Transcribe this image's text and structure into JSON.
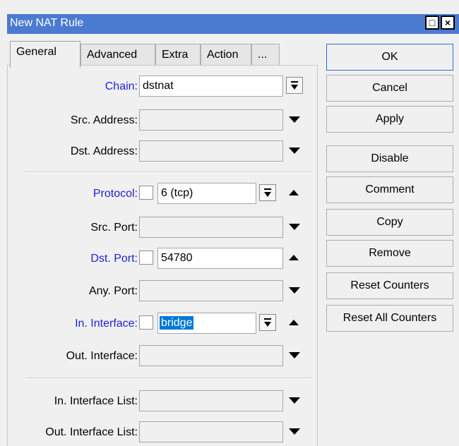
{
  "window": {
    "title": "New NAT Rule",
    "restore_label": "□",
    "close_label": "×"
  },
  "tabs": [
    "General",
    "Advanced",
    "Extra",
    "Action",
    "..."
  ],
  "fields": {
    "chain": {
      "label": "Chain:",
      "value": "dstnat"
    },
    "src_address": {
      "label": "Src. Address:",
      "value": ""
    },
    "dst_address": {
      "label": "Dst. Address:",
      "value": ""
    },
    "protocol": {
      "label": "Protocol:",
      "value": "6 (tcp)",
      "negate": false
    },
    "src_port": {
      "label": "Src. Port:",
      "value": ""
    },
    "dst_port": {
      "label": "Dst. Port:",
      "value": "54780",
      "negate": false
    },
    "any_port": {
      "label": "Any. Port:",
      "value": ""
    },
    "in_interface": {
      "label": "In. Interface:",
      "value": "bridge",
      "negate": false
    },
    "out_interface": {
      "label": "Out. Interface:",
      "value": ""
    },
    "in_interface_list": {
      "label": "In. Interface List:",
      "value": ""
    },
    "out_interface_list": {
      "label": "Out. Interface List:",
      "value": ""
    }
  },
  "buttons": {
    "ok": "OK",
    "cancel": "Cancel",
    "apply": "Apply",
    "disable": "Disable",
    "comment": "Comment",
    "copy": "Copy",
    "remove": "Remove",
    "reset_counters": "Reset Counters",
    "reset_all_counters": "Reset All Counters"
  },
  "colors": {
    "titlebar": "#4a7bd0",
    "active_label": "#1f1fd6",
    "selection": "#0078d7"
  }
}
